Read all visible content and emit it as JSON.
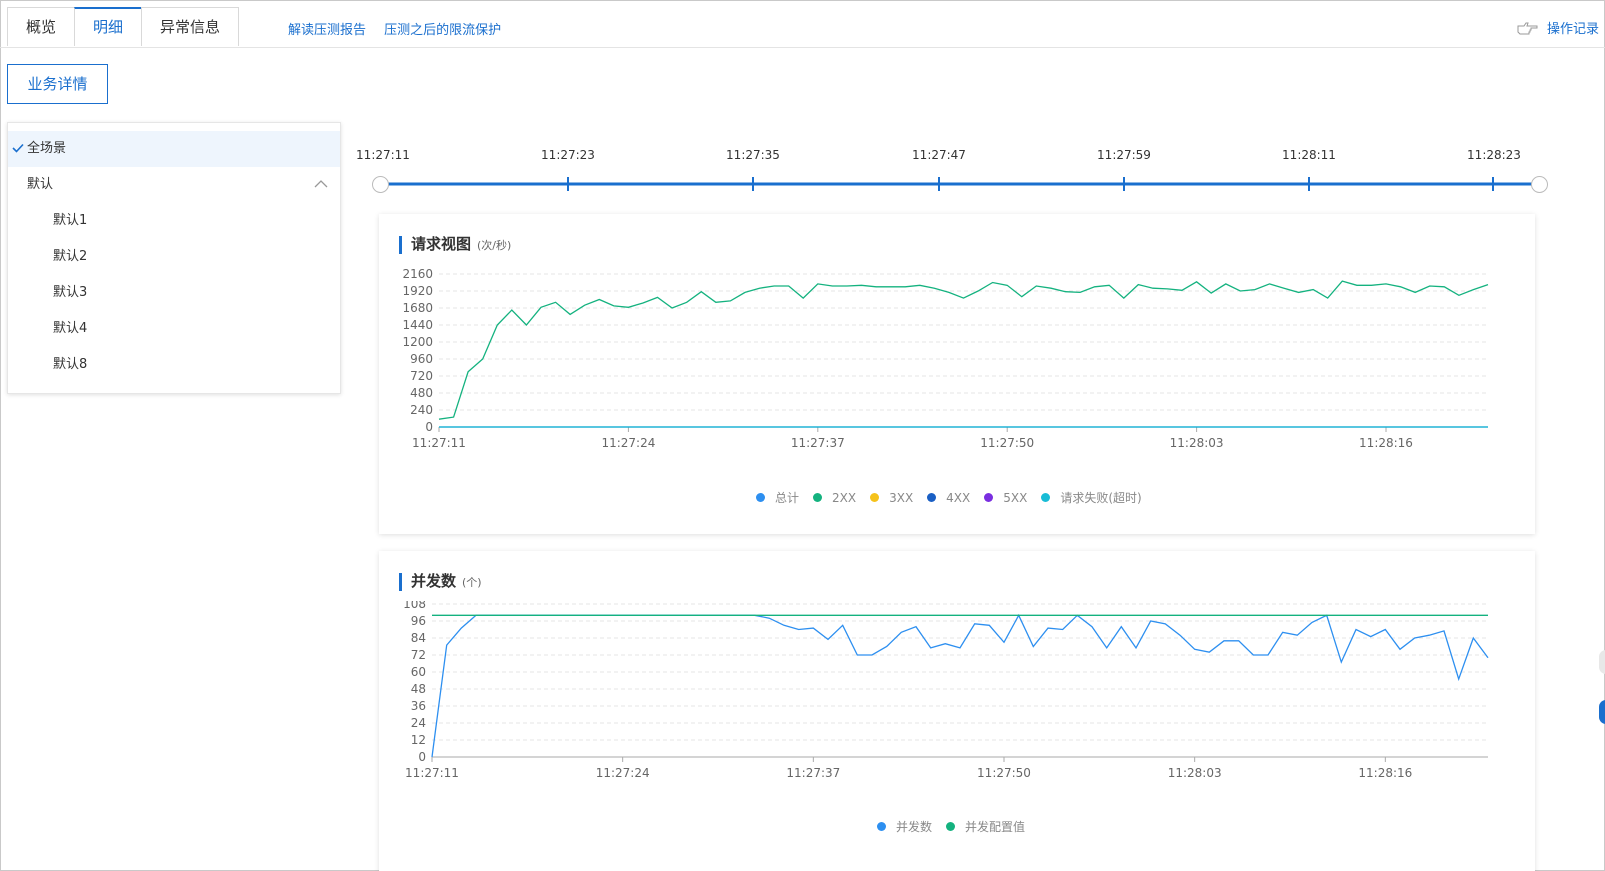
{
  "tabs": [
    {
      "label": "概览",
      "active": false
    },
    {
      "label": "明细",
      "active": true
    },
    {
      "label": "异常信息",
      "active": false
    }
  ],
  "links": {
    "report": "解读压测报告",
    "protect": "压测之后的限流保护"
  },
  "oplog": {
    "label": "操作记录",
    "icon": "hand-point-icon"
  },
  "biz_button": "业务详情",
  "tree": {
    "all": "全场景",
    "group": "默认",
    "items": [
      "默认1",
      "默认2",
      "默认3",
      "默认4",
      "默认8"
    ]
  },
  "timeline": {
    "labels": [
      "11:27:11",
      "11:27:23",
      "11:27:35",
      "11:27:47",
      "11:27:59",
      "11:28:11",
      "11:28:23"
    ]
  },
  "colors": {
    "accent": "#1a6fce",
    "green": "#14b27f",
    "blue": "#2d8ff0"
  },
  "chart_data": [
    {
      "type": "line",
      "title": "请求视图",
      "unit": "(次/秒)",
      "ylim": [
        0,
        2160
      ],
      "yticks": [
        0,
        240,
        480,
        720,
        960,
        1200,
        1440,
        1680,
        1920,
        2160
      ],
      "xticks": [
        "11:27:11",
        "11:27:24",
        "11:27:37",
        "11:27:50",
        "11:28:03",
        "11:28:16"
      ],
      "x_start": "11:27:11",
      "x_end": "11:28:24",
      "legend": [
        {
          "name": "总计",
          "color": "#2d8ff0"
        },
        {
          "name": "2XX",
          "color": "#14b27f"
        },
        {
          "name": "3XX",
          "color": "#f5c21b"
        },
        {
          "name": "4XX",
          "color": "#1a5fc4"
        },
        {
          "name": "5XX",
          "color": "#7a2ee0"
        },
        {
          "name": "请求失败(超时)",
          "color": "#18bcd6"
        }
      ],
      "series": [
        {
          "name": "2XX",
          "color": "#14b27f",
          "values": [
            110,
            140,
            780,
            960,
            1440,
            1650,
            1440,
            1690,
            1760,
            1590,
            1720,
            1800,
            1710,
            1690,
            1750,
            1830,
            1680,
            1760,
            1910,
            1760,
            1780,
            1900,
            1960,
            1990,
            1990,
            1820,
            2020,
            1990,
            1990,
            2000,
            1980,
            1980,
            1980,
            2000,
            1960,
            1900,
            1820,
            1920,
            2040,
            2000,
            1840,
            1990,
            1960,
            1910,
            1900,
            1980,
            2000,
            1820,
            2010,
            1960,
            1950,
            1930,
            2050,
            1890,
            2020,
            1920,
            1940,
            2020,
            1960,
            1900,
            1940,
            1820,
            2060,
            2000,
            2000,
            2020,
            1980,
            1900,
            1990,
            1980,
            1860,
            1940,
            2010
          ]
        },
        {
          "name": "4XX",
          "color": "#1a5fc4",
          "values": [
            0,
            0,
            0,
            0,
            0,
            0,
            0,
            0,
            0,
            0,
            0,
            0,
            0,
            0,
            0,
            0,
            0,
            0,
            0,
            0,
            0,
            0,
            0,
            0,
            0,
            0,
            0,
            0,
            0,
            0,
            0,
            0,
            0,
            0,
            0,
            0,
            0,
            0,
            0,
            0,
            0,
            0,
            0,
            0,
            0,
            0,
            0,
            0,
            0,
            0,
            0,
            0,
            0,
            0,
            0,
            0,
            0,
            0,
            0,
            0,
            0,
            0,
            0,
            0,
            0,
            0,
            0,
            0,
            0,
            0,
            0,
            0,
            0
          ]
        },
        {
          "name": "请求失败(超时)",
          "color": "#18bcd6",
          "values": [
            0,
            0,
            0,
            0,
            0,
            0,
            0,
            0,
            0,
            0,
            0,
            0,
            0,
            0,
            0,
            0,
            0,
            0,
            0,
            0,
            0,
            0,
            0,
            0,
            0,
            0,
            0,
            0,
            0,
            0,
            0,
            0,
            0,
            0,
            0,
            0,
            0,
            0,
            0,
            0,
            0,
            0,
            0,
            0,
            0,
            0,
            0,
            0,
            0,
            0,
            0,
            0,
            0,
            0,
            0,
            0,
            0,
            0,
            0,
            0,
            0,
            0,
            0,
            0,
            0,
            0,
            0,
            0,
            0,
            0,
            0,
            0,
            0
          ]
        }
      ]
    },
    {
      "type": "line",
      "title": "并发数",
      "unit": "(个)",
      "ylim": [
        0,
        108
      ],
      "yticks": [
        0,
        12,
        24,
        36,
        48,
        60,
        72,
        84,
        96,
        108
      ],
      "xticks": [
        "11:27:11",
        "11:27:24",
        "11:27:37",
        "11:27:50",
        "11:28:03",
        "11:28:16"
      ],
      "x_start": "11:27:11",
      "x_end": "11:28:24",
      "legend": [
        {
          "name": "并发数",
          "color": "#2d8ff0"
        },
        {
          "name": "并发配置值",
          "color": "#14b27f"
        }
      ],
      "series": [
        {
          "name": "并发数",
          "color": "#2d8ff0",
          "values": [
            0,
            79,
            91,
            100,
            100,
            100,
            100,
            100,
            100,
            100,
            100,
            100,
            100,
            100,
            100,
            100,
            100,
            100,
            100,
            100,
            100,
            100,
            100,
            98,
            93,
            90,
            91,
            83,
            93,
            72,
            72,
            78,
            88,
            92,
            77,
            80,
            77,
            94,
            93,
            81,
            100,
            78,
            91,
            90,
            100,
            92,
            77,
            92,
            77,
            96,
            94,
            86,
            76,
            74,
            82,
            82,
            72,
            72,
            88,
            86,
            95,
            100,
            67,
            90,
            85,
            90,
            76,
            84,
            86,
            89,
            55,
            84,
            70
          ]
        },
        {
          "name": "并发配置值",
          "color": "#14b27f",
          "values": [
            100,
            100,
            100,
            100,
            100,
            100,
            100,
            100,
            100,
            100,
            100,
            100,
            100,
            100,
            100,
            100,
            100,
            100,
            100,
            100,
            100,
            100,
            100,
            100,
            100,
            100,
            100,
            100,
            100,
            100,
            100,
            100,
            100,
            100,
            100,
            100,
            100,
            100,
            100,
            100,
            100,
            100,
            100,
            100,
            100,
            100,
            100,
            100,
            100,
            100,
            100,
            100,
            100,
            100,
            100,
            100,
            100,
            100,
            100,
            100,
            100,
            100,
            100,
            100,
            100,
            100,
            100,
            100,
            100,
            100,
            100,
            100,
            100
          ]
        }
      ]
    }
  ]
}
